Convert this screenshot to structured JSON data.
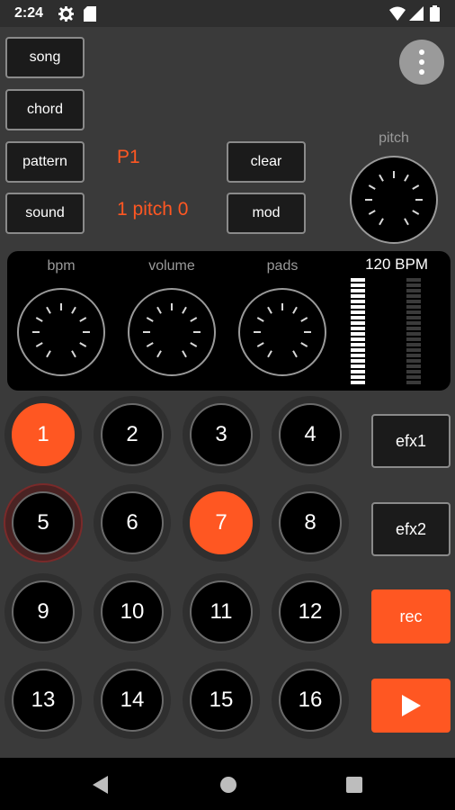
{
  "status_bar": {
    "time": "2:24",
    "icons": [
      "gear-icon",
      "sd-card-icon",
      "wifi-icon",
      "signal-icon",
      "battery-icon"
    ]
  },
  "left_buttons": {
    "song": "song",
    "chord": "chord",
    "pattern": "pattern",
    "sound": "sound"
  },
  "center_buttons": {
    "clear": "clear",
    "mod": "mod"
  },
  "info": {
    "pattern_id": "P1",
    "pad_pitch": "1 pitch 0"
  },
  "menu": {
    "icon": "more-vertical-icon"
  },
  "pitch_knob": {
    "label": "pitch"
  },
  "panel": {
    "bpm_label": "bpm",
    "volume_label": "volume",
    "pads_label": "pads",
    "bpm_display": "120 BPM"
  },
  "pads": [
    "1",
    "2",
    "3",
    "4",
    "5",
    "6",
    "7",
    "8",
    "9",
    "10",
    "11",
    "12",
    "13",
    "14",
    "15",
    "16"
  ],
  "active_pads": [
    "1",
    "7"
  ],
  "highlighted_pad": "5",
  "side_buttons": {
    "efx1": "efx1",
    "efx2": "efx2",
    "rec": "rec"
  },
  "play": {
    "icon": "play-icon"
  },
  "navigation": {
    "icons": [
      "back-icon",
      "home-icon",
      "recents-icon"
    ]
  },
  "colors": {
    "accent": "#ff5722",
    "background": "#3a3a3a",
    "panel": "#000000"
  }
}
